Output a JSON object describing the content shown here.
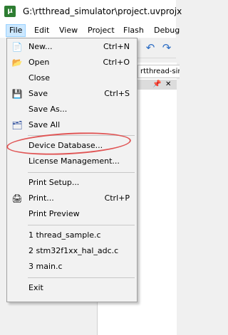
{
  "window": {
    "title": "G:\\rtthread_simulator\\project.uvprojx",
    "app_icon_label": "µ"
  },
  "menubar": {
    "items": [
      {
        "label": "File",
        "active": true
      },
      {
        "label": "Edit"
      },
      {
        "label": "View"
      },
      {
        "label": "Project"
      },
      {
        "label": "Flash"
      },
      {
        "label": "Debug"
      }
    ]
  },
  "toolbar": {
    "icons": [
      "undo-icon",
      "redo-icon"
    ]
  },
  "panel": {
    "tab_label": "rtthread-simulator",
    "pin_glyph": "📌",
    "close_glyph": "✕"
  },
  "file_menu": {
    "items": [
      {
        "label": "New...",
        "shortcut": "Ctrl+N",
        "icon": "new-file-icon"
      },
      {
        "label": "Open",
        "shortcut": "Ctrl+O",
        "icon": "open-folder-icon"
      },
      {
        "label": "Close",
        "shortcut": ""
      },
      {
        "label": "Save",
        "shortcut": "Ctrl+S",
        "icon": "save-icon"
      },
      {
        "label": "Save As...",
        "shortcut": ""
      },
      {
        "label": "Save All",
        "shortcut": "",
        "icon": "save-all-icon"
      },
      {
        "label": "Device Database...",
        "shortcut": ""
      },
      {
        "label": "License Management...",
        "shortcut": ""
      },
      {
        "label": "Print Setup...",
        "shortcut": ""
      },
      {
        "label": "Print...",
        "shortcut": "Ctrl+P",
        "icon": "print-icon"
      },
      {
        "label": "Print Preview",
        "shortcut": ""
      },
      {
        "label": "1 thread_sample.c",
        "shortcut": ""
      },
      {
        "label": "2 stm32f1xx_hal_adc.c",
        "shortcut": ""
      },
      {
        "label": "3 main.c",
        "shortcut": ""
      },
      {
        "label": "Exit",
        "shortcut": ""
      }
    ]
  },
  "annotation": {
    "highlighted_item": "License Management...",
    "color": "#e05555"
  }
}
